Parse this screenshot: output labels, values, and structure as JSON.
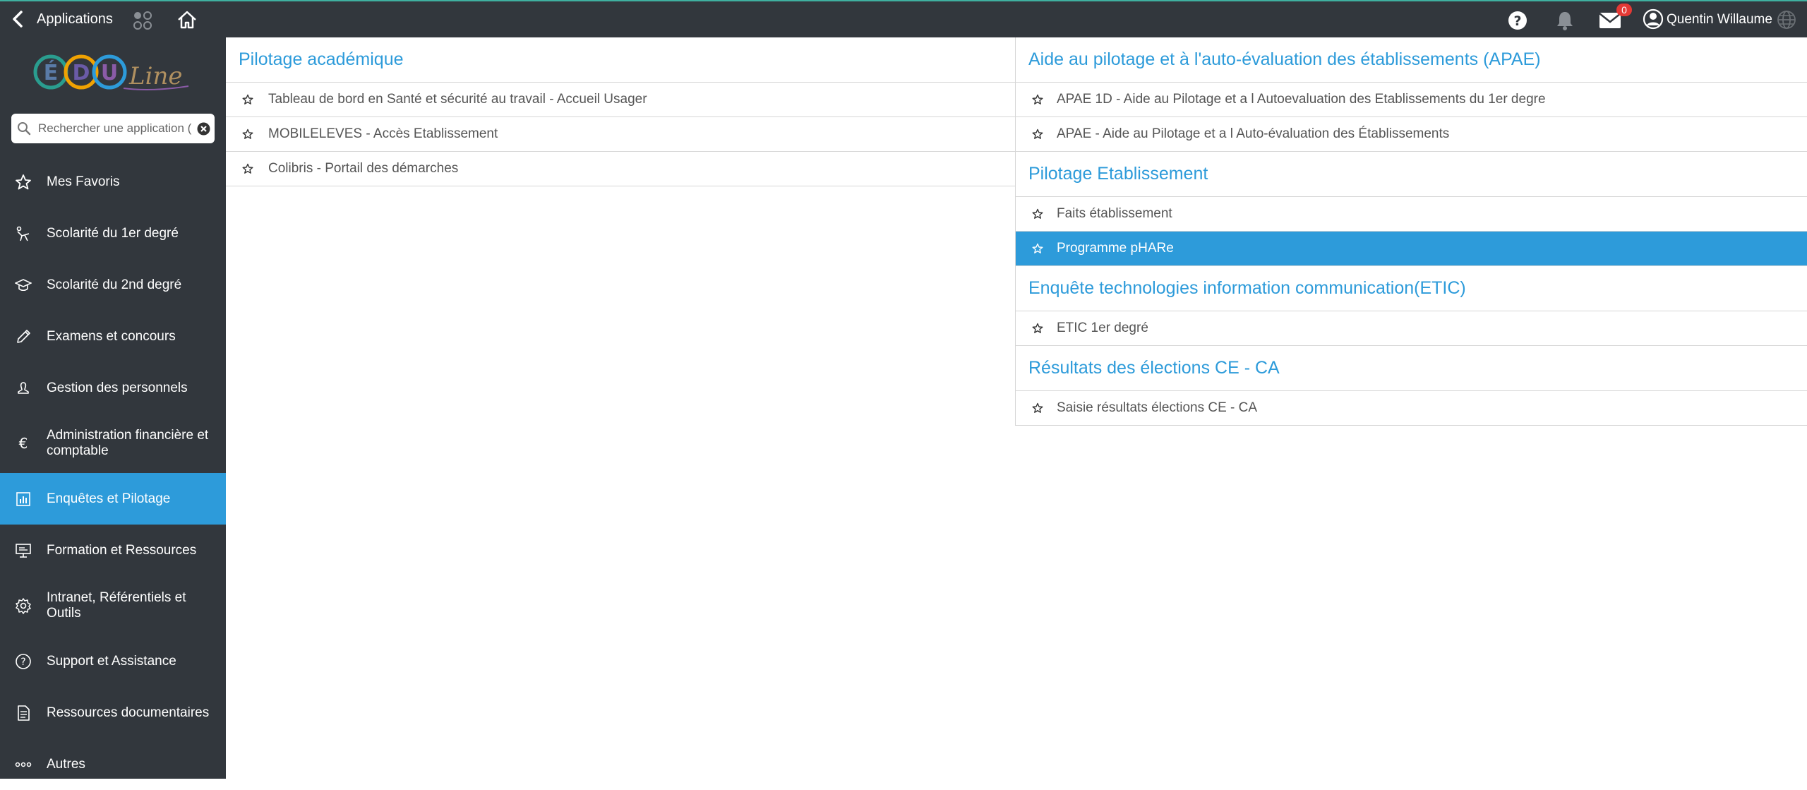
{
  "topbar": {
    "title": "Applications",
    "mail_count": "0",
    "user_name": "Quentin Willaume"
  },
  "sidebar": {
    "search_placeholder": "Rechercher une application (",
    "items": [
      {
        "label": "Mes Favoris",
        "icon": "star-icon"
      },
      {
        "label": "Scolarité du 1er degré",
        "icon": "child-icon"
      },
      {
        "label": "Scolarité du 2nd degré",
        "icon": "graduation-cap-icon"
      },
      {
        "label": "Examens et concours",
        "icon": "pencil-icon"
      },
      {
        "label": "Gestion des personnels",
        "icon": "person-icon"
      },
      {
        "label": "Administration financière et comptable",
        "icon": "euro-icon"
      },
      {
        "label": "Enquêtes et Pilotage",
        "icon": "bar-chart-icon"
      },
      {
        "label": "Formation et Ressources",
        "icon": "presentation-icon"
      },
      {
        "label": "Intranet, Référentiels et Outils",
        "icon": "gear-icon"
      },
      {
        "label": "Support et Assistance",
        "icon": "question-icon"
      },
      {
        "label": "Ressources documentaires",
        "icon": "document-icon"
      },
      {
        "label": "Autres",
        "icon": "more-icon"
      }
    ]
  },
  "left": {
    "title": "Pilotage académique",
    "items": [
      "Tableau de bord en Santé et sécurité au travail - Accueil Usager",
      "MOBILELEVES - Accès Etablissement",
      "Colibris - Portail des démarches"
    ]
  },
  "right": {
    "sections": [
      {
        "title": "Aide au pilotage et à l'auto-évaluation des établissements (APAE)",
        "items": [
          "APAE 1D - Aide au Pilotage et a l Autoevaluation des Etablissements du 1er degre",
          "APAE - Aide au Pilotage et a l Auto-évaluation des Établissements"
        ]
      },
      {
        "title": "Pilotage Etablissement",
        "items": [
          "Faits établissement",
          "Programme pHARe"
        ]
      },
      {
        "title": "Enquête technologies information communication(ETIC)",
        "items": [
          "ETIC 1er degré"
        ]
      },
      {
        "title": "Résultats des élections CE - CA",
        "items": [
          "Saisie résultats élections CE - CA"
        ]
      }
    ]
  },
  "colors": {
    "topbar": "#32373d",
    "sidebar": "#32373d",
    "accent": "#2d9bda",
    "badge": "#e53935"
  }
}
